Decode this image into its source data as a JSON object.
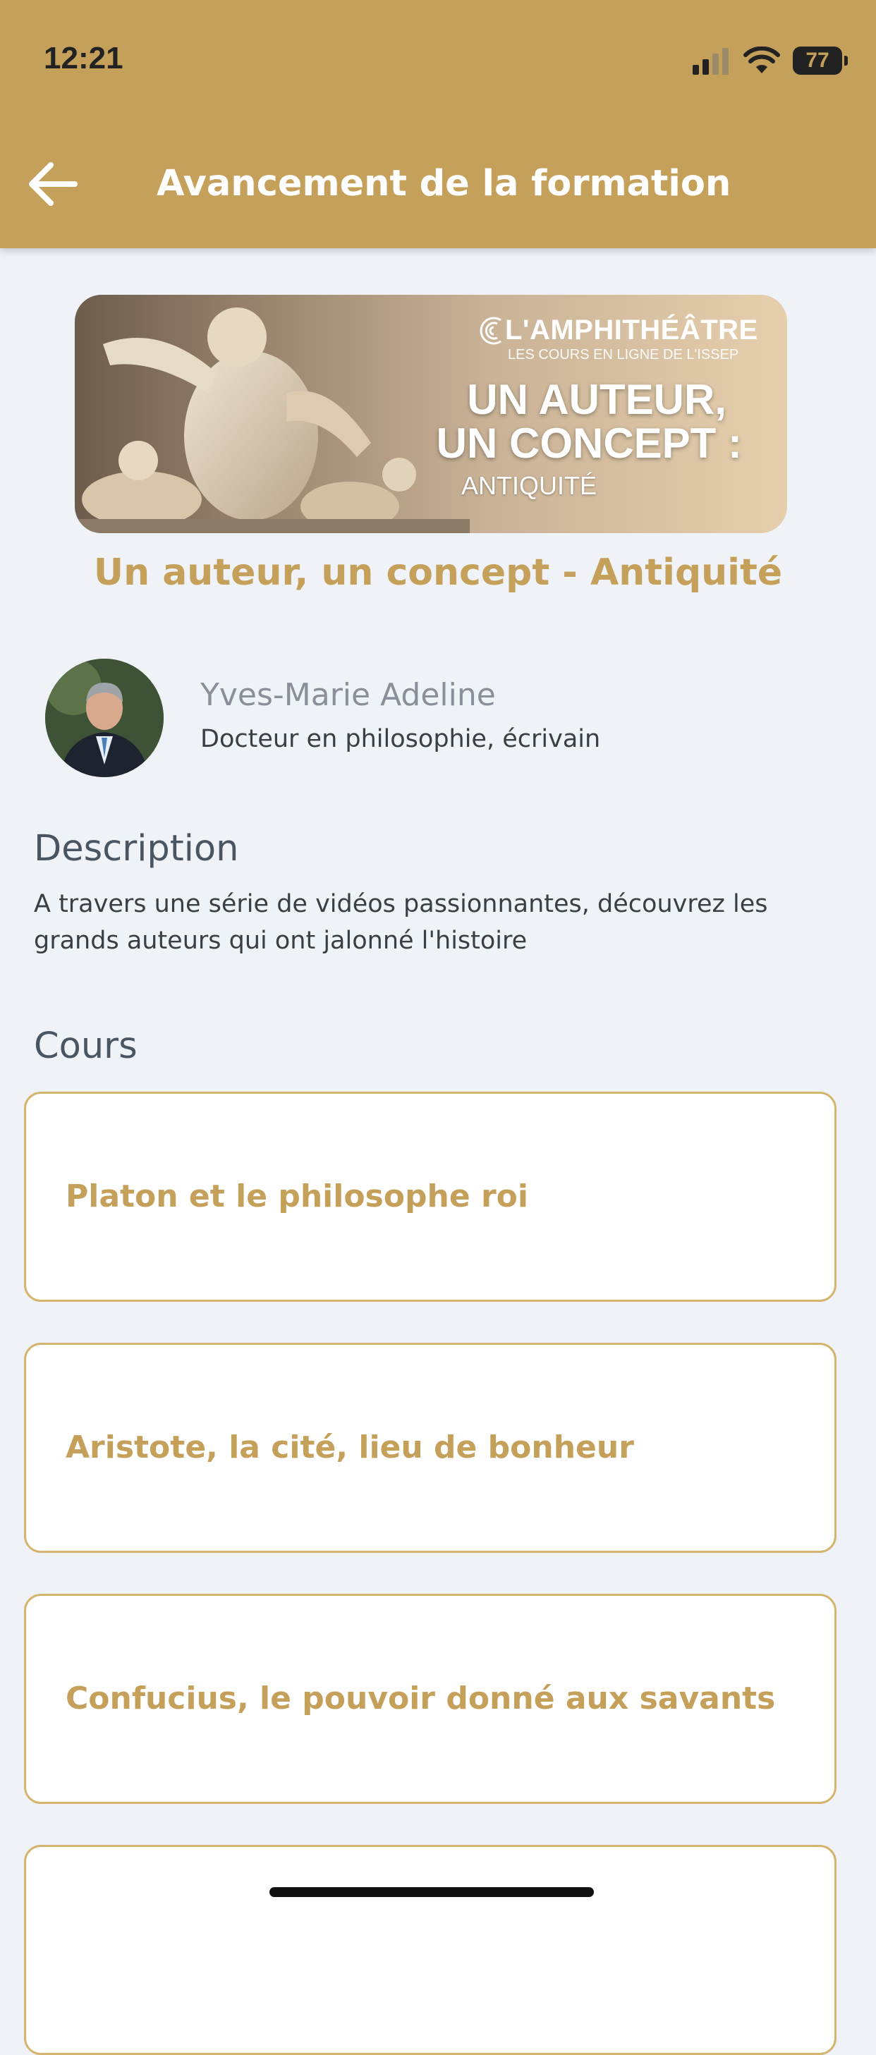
{
  "status_bar": {
    "time": "12:21",
    "battery": "77"
  },
  "header": {
    "title": "Avancement de la formation",
    "back_icon": "arrow-left-icon"
  },
  "banner": {
    "brand": "L'AMPHITHÉÂTRE",
    "brand_subtitle": "LES COURS EN LIGNE DE L'ISSEP",
    "heading_line1": "UN AUTEUR,",
    "heading_line2": "UN CONCEPT :",
    "subheading": "ANTIQUITÉ"
  },
  "course": {
    "title": "Un auteur, un concept - Antiquité"
  },
  "author": {
    "name": "Yves-Marie Adeline",
    "role": "Docteur en philosophie, écrivain"
  },
  "description": {
    "title": "Description",
    "text": "A travers une série de vidéos passionnantes, découvrez les grands auteurs qui ont jalonné l'histoire"
  },
  "lessons": {
    "title": "Cours",
    "items": [
      {
        "label": "Platon et le philosophe roi"
      },
      {
        "label": "Aristote, la cité, lieu de bonheur"
      },
      {
        "label": "Confucius, le pouvoir donné aux savants"
      },
      {
        "label": ""
      }
    ]
  },
  "colors": {
    "accent": "#c5a05a",
    "background": "#eff2f7",
    "card_border": "#d4b46e"
  }
}
